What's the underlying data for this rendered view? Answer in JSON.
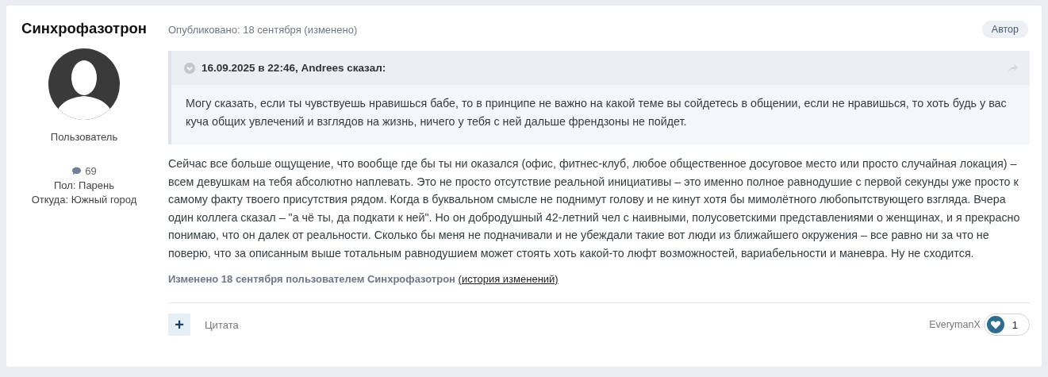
{
  "author": {
    "name": "Синхрофазотрон",
    "role": "Пользователь",
    "posts": "69",
    "gender": "Пол: Парень",
    "location": "Откуда: Южный город"
  },
  "post": {
    "published": "Опубликовано: 18 сентября (изменено)",
    "badge": "Автор",
    "quote": {
      "header": "16.09.2025 в 22:46, Andrees сказал:",
      "text": "Могу сказать, если ты чувствуешь нравишься бабе, то в принципе не важно на какой теме вы сойдетесь в общении, если не нравишься, то хоть будь у вас куча общих увлечений и взглядов на жизнь, ничего у тебя с ней дальше френдзоны не пойдет."
    },
    "body": "Сейчас все больше ощущение, что вообще где бы ты ни оказался (офис, фитнес-клуб, любое общественное досуговое место или просто случайная локация) – всем девушкам на тебя абсолютно наплевать. Это не просто отсутствие реальной инициативы – это именно полное равнодушие с первой секунды уже просто к самому факту твоего присутствия рядом. Когда в буквальном смысле не поднимут голову и не кинут хотя бы мимолётного любопытствующего взгляда. Вчера один коллега сказал – \"а чё ты, да подкати к ней\". Но он добродушный 42-летний чел с наивными, полусоветскими представлениями о женщинах, и я прекрасно понимаю, что он далек от реальности. Сколько бы меня не подначивали и не убеждали такие вот люди из ближайшего окружения – все равно ни за что не поверю, что за описанным выше тотальным равнодушием может стоять хоть какой-то люфт возможностей, вариабельности и маневра. Ну не сходится.",
    "edited": "Изменено 18 сентября пользователем Синхрофазотрон",
    "history_link": "(история изменений)",
    "plus": "+",
    "quote_button": "Цитата",
    "liked_by": "EverymanX",
    "likes": "1"
  }
}
